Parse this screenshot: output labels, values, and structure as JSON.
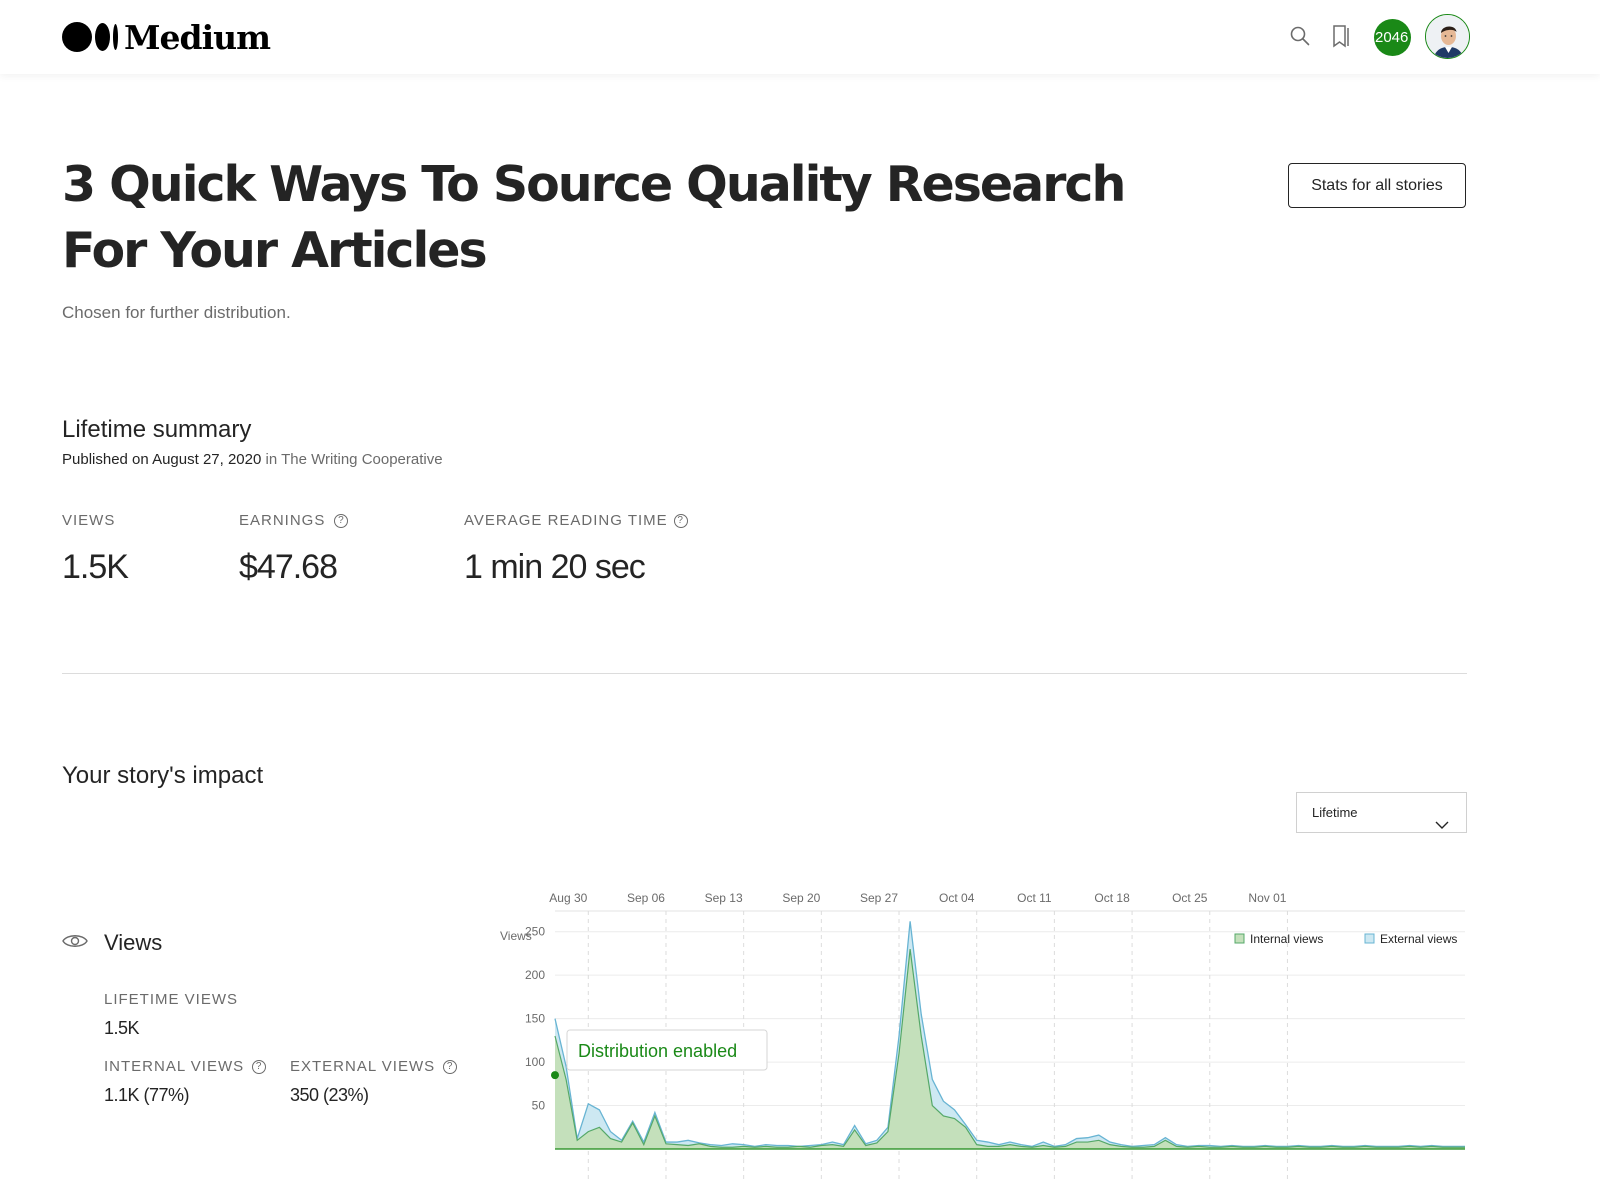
{
  "brand": {
    "name": "Medium"
  },
  "header": {
    "search_icon": "search-icon",
    "bookmark_icon": "bookmarks-icon",
    "notifications_count": "2046",
    "avatar": "user-avatar"
  },
  "story": {
    "title": "3 Quick Ways To Source Quality Research For Your Articles",
    "distribution_note": "Chosen for further distribution.",
    "stats_all_button": "Stats for all stories"
  },
  "lifetime_summary": {
    "heading": "Lifetime summary",
    "published_prefix": "Published on",
    "published_date": "August 27, 2020",
    "published_in": "in",
    "publication": "The Writing Cooperative",
    "metrics": {
      "views_label": "VIEWS",
      "views_value": "1.5K",
      "earnings_label": "EARNINGS",
      "earnings_value": "$47.68",
      "reading_label": "AVERAGE READING TIME",
      "reading_value": "1 min 20 sec"
    }
  },
  "impact": {
    "heading": "Your story's impact",
    "range_selected": "Lifetime",
    "views_heading": "Views",
    "lifetime_views_label": "LIFETIME VIEWS",
    "lifetime_views_value": "1.5K",
    "internal_views_label": "INTERNAL VIEWS",
    "internal_views_value": "1.1K (77%)",
    "external_views_label": "EXTERNAL VIEWS",
    "external_views_value": "350 (23%)"
  },
  "colors": {
    "accent_green": "#1a8917",
    "internal_fill": "#c4e0bb",
    "internal_line": "#55a868",
    "external_fill": "#cde8f2",
    "external_line": "#68b4d3"
  },
  "chart_data": {
    "type": "area",
    "ylabel": "Views",
    "x_tick_labels": [
      "Aug 30",
      "Sep 06",
      "Sep 13",
      "Sep 20",
      "Sep 27",
      "Oct 04",
      "Oct 11",
      "Oct 18",
      "Oct 25",
      "Nov 01"
    ],
    "x_start": "Aug 27",
    "y_ticks": [
      50,
      100,
      150,
      200,
      250
    ],
    "ylim": [
      0,
      275
    ],
    "grid": true,
    "legend": "top-right",
    "annotation": "Distribution enabled",
    "series": [
      {
        "name": "Internal views",
        "values": [
          130,
          80,
          10,
          20,
          25,
          12,
          8,
          30,
          5,
          38,
          6,
          5,
          4,
          6,
          3,
          2,
          2,
          3,
          2,
          3,
          2,
          2,
          3,
          2,
          4,
          5,
          3,
          22,
          4,
          7,
          20,
          110,
          230,
          130,
          50,
          38,
          35,
          25,
          5,
          3,
          3,
          5,
          3,
          2,
          4,
          2,
          3,
          8,
          8,
          10,
          5,
          3,
          2,
          2,
          3,
          10,
          3,
          2,
          3,
          2,
          2,
          3,
          2,
          2,
          3,
          2,
          2,
          3,
          2,
          2,
          3,
          2,
          2,
          3,
          2,
          2,
          2,
          3,
          2,
          3,
          2,
          2,
          2
        ]
      },
      {
        "name": "External views",
        "values": [
          150,
          95,
          12,
          52,
          45,
          20,
          10,
          32,
          8,
          42,
          8,
          8,
          10,
          7,
          5,
          4,
          6,
          5,
          3,
          5,
          4,
          4,
          3,
          4,
          5,
          8,
          5,
          27,
          6,
          10,
          25,
          130,
          262,
          155,
          80,
          55,
          45,
          28,
          10,
          8,
          5,
          8,
          5,
          3,
          8,
          3,
          5,
          12,
          13,
          16,
          8,
          5,
          3,
          4,
          5,
          13,
          5,
          3,
          4,
          4,
          3,
          4,
          3,
          3,
          4,
          3,
          3,
          4,
          3,
          3,
          4,
          3,
          3,
          4,
          3,
          3,
          3,
          4,
          3,
          4,
          3,
          3,
          3
        ]
      }
    ]
  }
}
